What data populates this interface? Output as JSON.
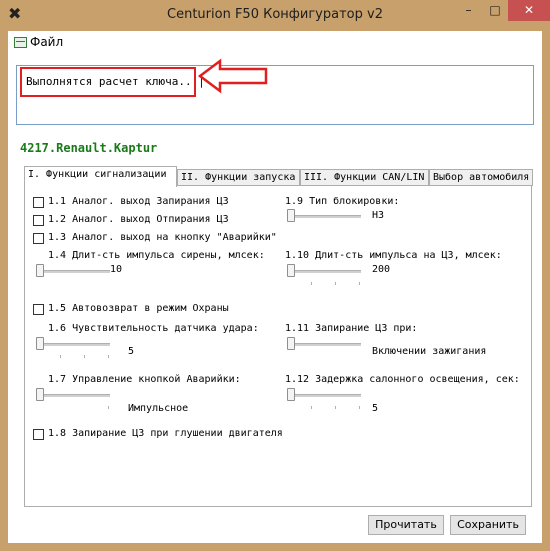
{
  "window": {
    "title": "Centurion F50 Конфигуратор v2",
    "minimize": "–",
    "maximize": "□",
    "close": "✕"
  },
  "menu": {
    "file": "Файл"
  },
  "log": {
    "text": "Выполнятся расчет ключа...|"
  },
  "vehicle": "4217.Renault.Kaptur",
  "tabs": [
    {
      "label": "I. Функции сигнализации"
    },
    {
      "label": "II. Функции запуска"
    },
    {
      "label": "III. Функции CAN/LIN"
    },
    {
      "label": "Выбор автомобиля"
    }
  ],
  "settings": {
    "s1_1": "1.1 Аналог. выход Запирания ЦЗ",
    "s1_2": "1.2 Аналог. выход Отпирания ЦЗ",
    "s1_3": "1.3 Аналог. выход на кнопку \"Аварийки\"",
    "s1_4": "1.4 Длит-сть импульса сирены, млсек:",
    "s1_4_value": "10",
    "s1_5": "1.5 Автовозврат в режим Охраны",
    "s1_6": "1.6 Чувствительность датчика удара:",
    "s1_6_value": "5",
    "s1_7": "1.7 Управление кнопкой Аварийки:",
    "s1_7_value": "Импульсное",
    "s1_8": "1.8 Запирание ЦЗ при глушении двигателя",
    "s1_9": "1.9  Тип блокировки:",
    "s1_9_value": "НЗ",
    "s1_10": "1.10 Длит-сть импульса на ЦЗ, млсек:",
    "s1_10_value": "200",
    "s1_11": "1.11 Запирание ЦЗ при:",
    "s1_11_value": "Включении зажигания",
    "s1_12": "1.12 Задержка салонного освещения, сек:",
    "s1_12_value": "5"
  },
  "buttons": {
    "read": "Прочитать",
    "save": "Сохранить"
  },
  "colors": {
    "window_frame": "#c8a06c",
    "close_button": "#c75050",
    "vehicle_text": "#1a7a1a",
    "highlight": "#e02020"
  },
  "icons": {
    "app": "tools-icon",
    "file": "menu-file-icon"
  }
}
